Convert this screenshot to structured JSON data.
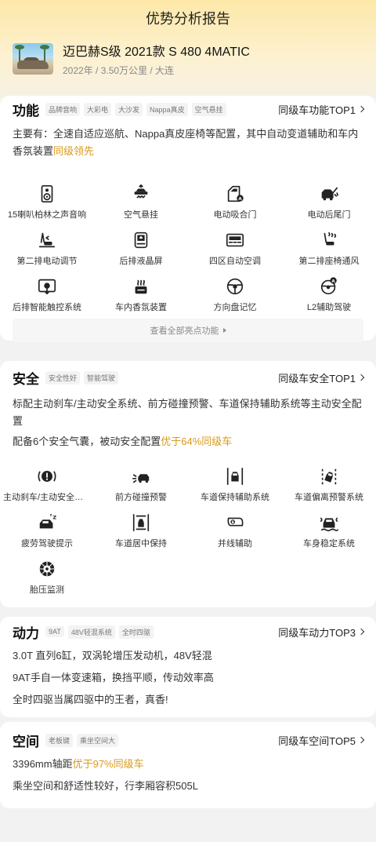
{
  "page": {
    "title": "优势分析报告"
  },
  "car": {
    "name": "迈巴赫S级 2021款 S 480 4MATIC",
    "meta": "2022年 / 3.50万公里 / 大连"
  },
  "function": {
    "title": "功能",
    "tags": [
      "品牌音响",
      "大彩电",
      "大沙发",
      "Nappa真皮",
      "空气悬挂"
    ],
    "rank": "同级车功能TOP1",
    "desc_main": "主要有：全速自适应巡航、Nappa真皮座椅等配置，其中自动变道辅助和车内香氛装置",
    "desc_hl": "同级领先",
    "features": [
      {
        "label": "15喇叭柏林之声音响",
        "icon": "speaker-icon"
      },
      {
        "label": "空气悬挂",
        "icon": "air-suspension-icon"
      },
      {
        "label": "电动吸合门",
        "icon": "soft-close-door-icon"
      },
      {
        "label": "电动后尾门",
        "icon": "power-tailgate-icon"
      },
      {
        "label": "第二排电动调节",
        "icon": "rear-seat-adjust-icon"
      },
      {
        "label": "后排液晶屏",
        "icon": "rear-screen-icon"
      },
      {
        "label": "四区自动空调",
        "icon": "climate-control-icon"
      },
      {
        "label": "第二排座椅通风",
        "icon": "seat-ventilation-icon"
      },
      {
        "label": "后排智能触控系统",
        "icon": "touch-control-icon"
      },
      {
        "label": "车内香氛装置",
        "icon": "fragrance-icon"
      },
      {
        "label": "方向盘记忆",
        "icon": "steering-memory-icon"
      },
      {
        "label": "L2辅助驾驶",
        "icon": "l2-assist-icon"
      }
    ],
    "more": "查看全部亮点功能"
  },
  "safety": {
    "title": "安全",
    "tags": [
      "安全性好",
      "智能驾驶"
    ],
    "rank": "同级车安全TOP1",
    "desc1": "标配主动刹车/主动安全系统、前方碰撞预警、车道保持辅助系统等主动安全配置",
    "desc2_main": "配备6个安全气囊，被动安全配置",
    "desc2_hl": "优于64%同级车",
    "features": [
      {
        "label": "主动刹车/主动安全系统",
        "icon": "auto-brake-icon"
      },
      {
        "label": "前方碰撞预警",
        "icon": "collision-warning-icon"
      },
      {
        "label": "车道保持辅助系统",
        "icon": "lane-keep-icon"
      },
      {
        "label": "车道偏离预警系统",
        "icon": "lane-departure-icon"
      },
      {
        "label": "疲劳驾驶提示",
        "icon": "fatigue-icon"
      },
      {
        "label": "车道居中保持",
        "icon": "lane-center-icon"
      },
      {
        "label": "并线辅助",
        "icon": "blind-spot-icon"
      },
      {
        "label": "车身稳定系统",
        "icon": "stability-icon"
      },
      {
        "label": "胎压监测",
        "icon": "tire-pressure-icon"
      }
    ]
  },
  "power": {
    "title": "动力",
    "tags": [
      "9AT",
      "48V轻混系统",
      "全时四驱"
    ],
    "rank": "同级车动力TOP3",
    "lines": [
      "3.0T 直列6缸，双涡轮增压发动机，48V轻混",
      "9AT手自一体变速箱，换挡平顺，传动效率高",
      "全时四驱当属四驱中的王者，真香!"
    ]
  },
  "space": {
    "title": "空间",
    "tags": [
      "老板键",
      "乘坐空间大"
    ],
    "rank": "同级车空间TOP5",
    "line1_main": "3396mm轴距",
    "line1_hl": "优于97%同级车",
    "line2": "乘坐空间和舒适性较好，行李厢容积505L"
  }
}
